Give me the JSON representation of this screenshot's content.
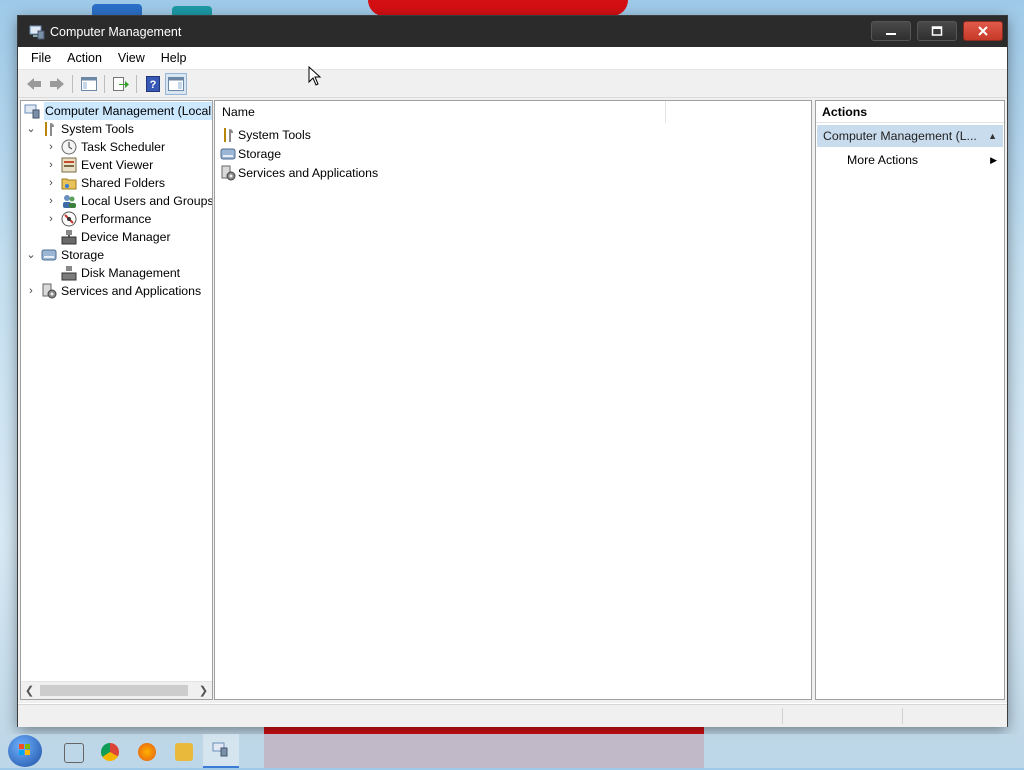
{
  "window": {
    "title": "Computer Management",
    "menu": [
      "File",
      "Action",
      "View",
      "Help"
    ]
  },
  "toolbar": {
    "buttons": [
      "back-icon",
      "forward-icon",
      "show-hide-console-tree-icon",
      "export-list-icon",
      "help-icon",
      "show-hide-action-pane-icon"
    ]
  },
  "tree": {
    "root": "Computer Management (Local",
    "items": [
      {
        "label": "System Tools",
        "icon": "tools-icon",
        "expanded": true
      },
      {
        "label": "Task Scheduler",
        "icon": "clock-icon"
      },
      {
        "label": "Event Viewer",
        "icon": "event-viewer-icon"
      },
      {
        "label": "Shared Folders",
        "icon": "shared-folder-icon"
      },
      {
        "label": "Local Users and Groups",
        "icon": "users-icon"
      },
      {
        "label": "Performance",
        "icon": "performance-icon"
      },
      {
        "label": "Device Manager",
        "icon": "device-manager-icon"
      },
      {
        "label": "Storage",
        "icon": "storage-icon",
        "expanded": true
      },
      {
        "label": "Disk Management",
        "icon": "disk-icon"
      },
      {
        "label": "Services and Applications",
        "icon": "services-icon"
      }
    ]
  },
  "list": {
    "columns": [
      "Name",
      ""
    ],
    "rows": [
      "System Tools",
      "Storage",
      "Services and Applications"
    ]
  },
  "actions": {
    "title": "Actions",
    "section": "Computer Management (L...",
    "items": [
      "More Actions"
    ]
  },
  "colors": {
    "titlebar": "#2b2b2b",
    "close_button": "#c63a28",
    "selection": "#cce8ff",
    "actions_header": "#c9dcee"
  }
}
